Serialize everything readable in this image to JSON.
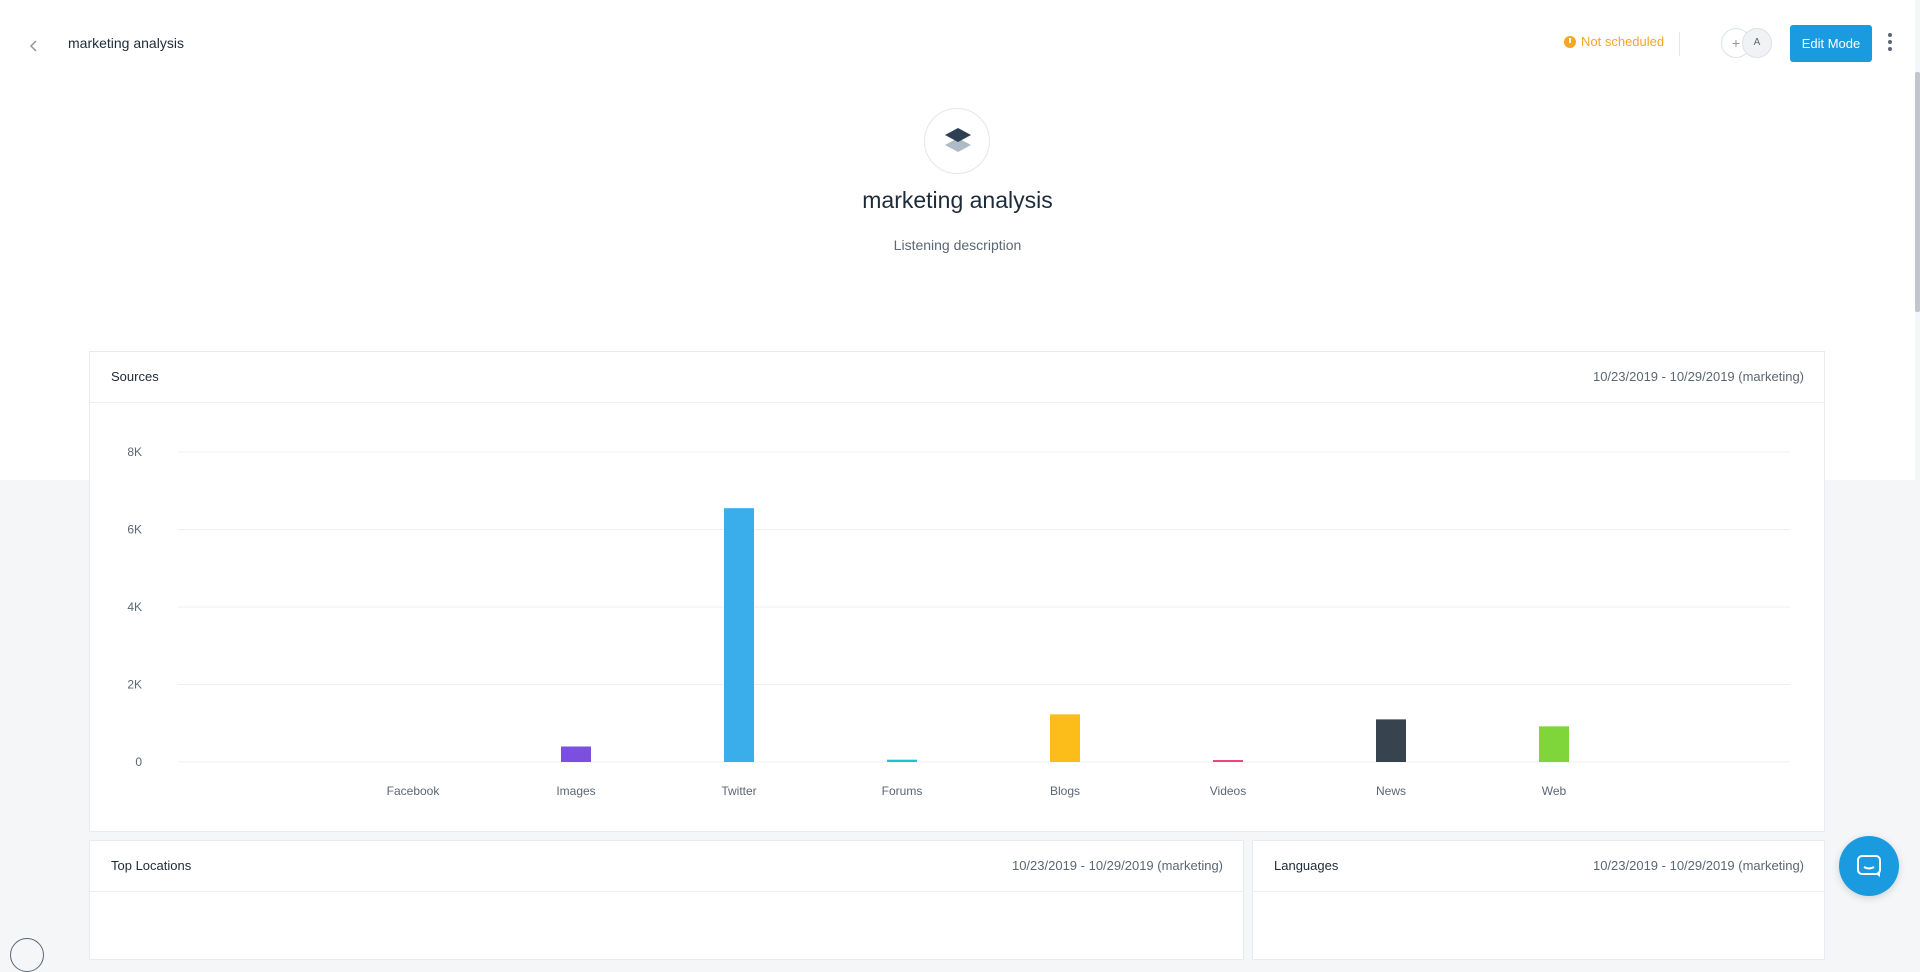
{
  "header": {
    "back_icon": "chevron-left-icon",
    "title": "marketing analysis",
    "status": "Not scheduled",
    "status_icon": "clock-icon",
    "add_member": "+",
    "avatar_initial": "A",
    "edit_button": "Edit Mode",
    "more_icon": "vertical-dots-icon"
  },
  "project": {
    "icon": "layers-icon",
    "title": "marketing analysis",
    "description": "Listening description"
  },
  "sources_card": {
    "title": "Sources",
    "date_range": "10/23/2019 - 10/29/2019 (marketing)"
  },
  "top_locations_card": {
    "title": "Top Locations",
    "date_range": "10/23/2019 - 10/29/2019 (marketing)"
  },
  "languages_card": {
    "title": "Languages",
    "date_range": "10/23/2019 - 10/29/2019 (marketing)"
  },
  "colors": {
    "accent": "#1a9be0",
    "status": "#f5a623"
  },
  "chart_data": {
    "type": "bar",
    "categories": [
      "Facebook",
      "Images",
      "Twitter",
      "Forums",
      "Blogs",
      "Videos",
      "News",
      "Web"
    ],
    "values": [
      0,
      400,
      6550,
      60,
      1230,
      40,
      1100,
      920
    ],
    "colors": [
      "#1a9be0",
      "#7b4fe0",
      "#3aaeea",
      "#17c3d8",
      "#fcbd1a",
      "#f0447c",
      "#37444f",
      "#7fd63a"
    ],
    "y_ticks": [
      "0",
      "2K",
      "4K",
      "6K",
      "8K"
    ],
    "ylim": [
      0,
      8000
    ],
    "grid": true
  }
}
